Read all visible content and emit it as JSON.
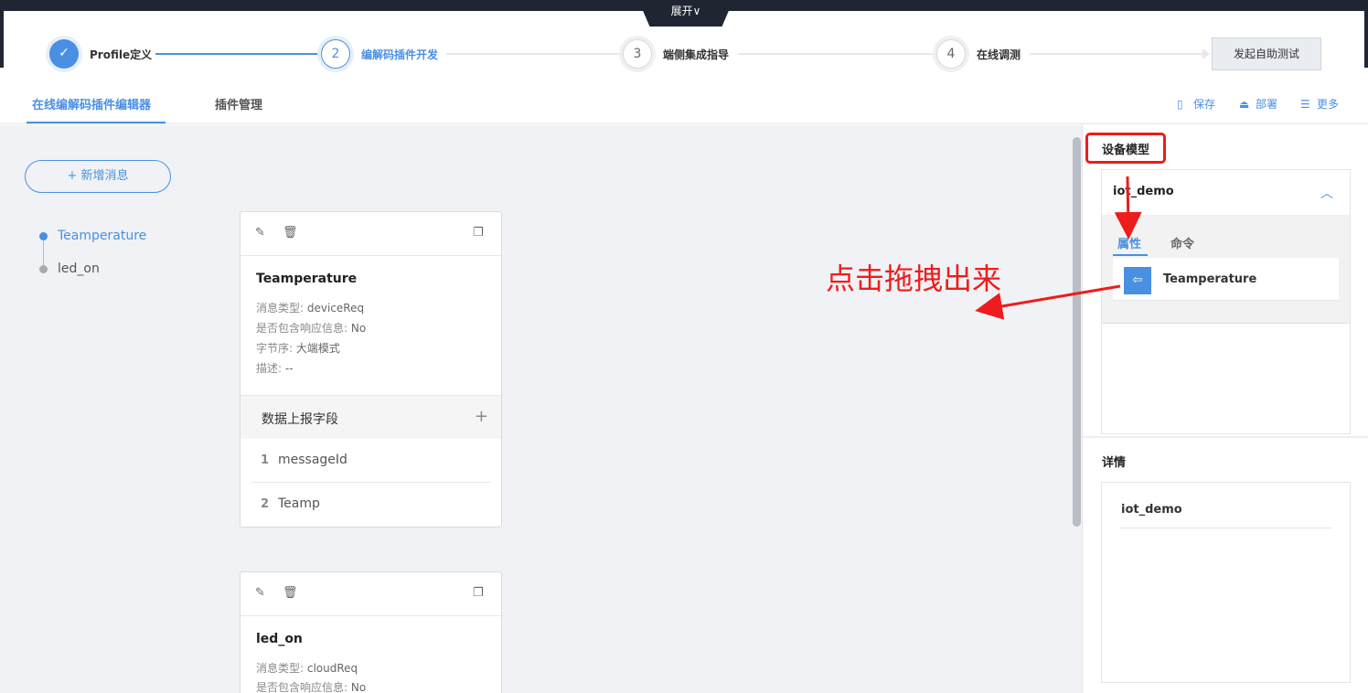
{
  "topbar": {
    "expand_label": "展开∨"
  },
  "steps": [
    {
      "num": "✓",
      "label": "Profile定义"
    },
    {
      "num": "2",
      "label": "编解码插件开发"
    },
    {
      "num": "3",
      "label": "端侧集成指导"
    },
    {
      "num": "4",
      "label": "在线调测"
    }
  ],
  "selftest_label": "发起自助测试",
  "tabs": {
    "editor": "在线编解码插件编辑器",
    "manage": "插件管理"
  },
  "toolbar": {
    "save": "保存",
    "deploy": "部署",
    "more": "更多"
  },
  "add_message_label": "+ 新增消息",
  "tree": [
    "Teamperature",
    "led_on"
  ],
  "cards": [
    {
      "title": "Teamperature",
      "info": [
        {
          "k": "消息类型: ",
          "v": "deviceReq"
        },
        {
          "k": "是否包含响应信息: ",
          "v": "No"
        },
        {
          "k": "字节序: ",
          "v": "大端模式"
        },
        {
          "k": "描述: ",
          "v": "--"
        }
      ],
      "section": "数据上报字段",
      "fields": [
        {
          "idx": "1",
          "name": "messageId"
        },
        {
          "idx": "2",
          "name": "Teamp"
        }
      ]
    },
    {
      "title": "led_on",
      "info": [
        {
          "k": "消息类型: ",
          "v": "cloudReq"
        },
        {
          "k": "是否包含响应信息: ",
          "v": "No"
        }
      ]
    }
  ],
  "annotation": "点击拖拽出来",
  "sidebar": {
    "title": "设备模型",
    "model_name": "iot_demo",
    "tab_props": "属性",
    "tab_cmds": "命令",
    "prop_item": "Teamperature",
    "detail_title": "详情",
    "detail_name": "iot_demo"
  },
  "colors": {
    "accent": "#4a90e2",
    "annotation": "#ee1c1c"
  }
}
